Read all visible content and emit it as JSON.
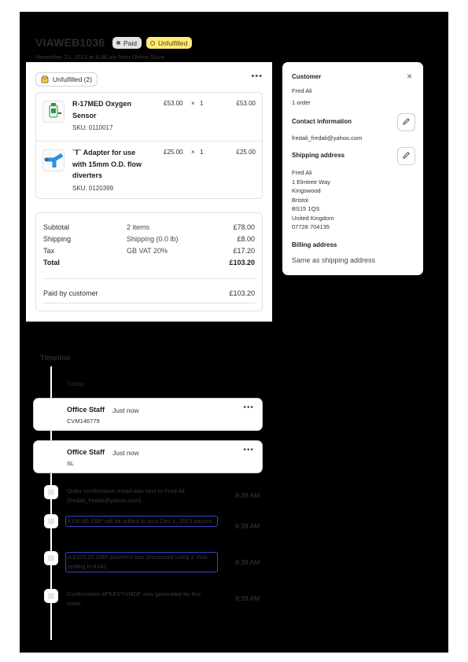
{
  "header": {
    "order_id": "VIAWEB1036",
    "paid_label": "Paid",
    "unfulfilled_label": "Unfulfilled",
    "subtitle": "November 21, 2023 at 8:38 am from Online Store"
  },
  "fulfillment": {
    "status_label": "Unfulfilled (2)",
    "more_label": "•••",
    "items": [
      {
        "name": "R-17MED Oxygen Sensor",
        "sku": "SKU: 0110017",
        "price": "£53.00",
        "times": "×",
        "qty": "1",
        "total": "£53.00"
      },
      {
        "name": "`T` Adapter for use with 15mm O.D. flow diverters",
        "sku": "SKU: 0120399",
        "price": "£25.00",
        "times": "×",
        "qty": "1",
        "total": "£25.00"
      }
    ]
  },
  "summary": {
    "subtotal": {
      "label": "Subtotal",
      "detail": "2 items",
      "amount": "£78.00"
    },
    "shipping": {
      "label": "Shipping",
      "detail": "Shipping (0.0 lb)",
      "amount": "£8.00"
    },
    "tax": {
      "label": "Tax",
      "detail": "GB VAT 20%",
      "amount": "£17.20"
    },
    "total": {
      "label": "Total",
      "amount": "£103.20"
    },
    "paid": {
      "label": "Paid by customer",
      "amount": "£103.20"
    }
  },
  "customer": {
    "heading": "Customer",
    "close": "×",
    "name": "Fred Ali",
    "orders": "1 order",
    "contact_heading": "Contact information",
    "email": "fredali_fredali@yahoo.com",
    "shipping_heading": "Shipping address",
    "address": [
      "Fred Ali",
      "1 Elmtree Way",
      "Kingswood",
      "Bristol",
      "BS15 1QS",
      "United Kingdom",
      "07728 704135"
    ],
    "billing_heading": "Billing address",
    "billing_text": "Same as shipping address"
  },
  "timeline": {
    "title": "Timeline",
    "today": "Today",
    "comments": [
      {
        "author": "Office Staff",
        "time": "Just now",
        "text": "CVM146779",
        "more": "•••"
      },
      {
        "author": "Office Staff",
        "time": "Just now",
        "text": "SL",
        "more": "•••"
      }
    ],
    "events": [
      {
        "text": "Order confirmation email was sent to Fred Ali (fredali_fredali@yahoo.com).",
        "time": "8:39 AM"
      },
      {
        "text": "£100.86 GBP will be added to your Dec 1, 2023 payout.",
        "time": "8:39 AM"
      },
      {
        "text": "A £103.20 GBP payment was processed using a Visa ending in 8142.",
        "time": "8:39 AM"
      },
      {
        "text": "Confirmation #FKEVYVMDF was generated for this order.",
        "time": "8:39 AM"
      }
    ]
  },
  "colors": {
    "backdrop": "#000000",
    "card": "#ffffff",
    "unfulfilled_badge": "#ffeb78",
    "link_outline": "#3a44c9"
  }
}
